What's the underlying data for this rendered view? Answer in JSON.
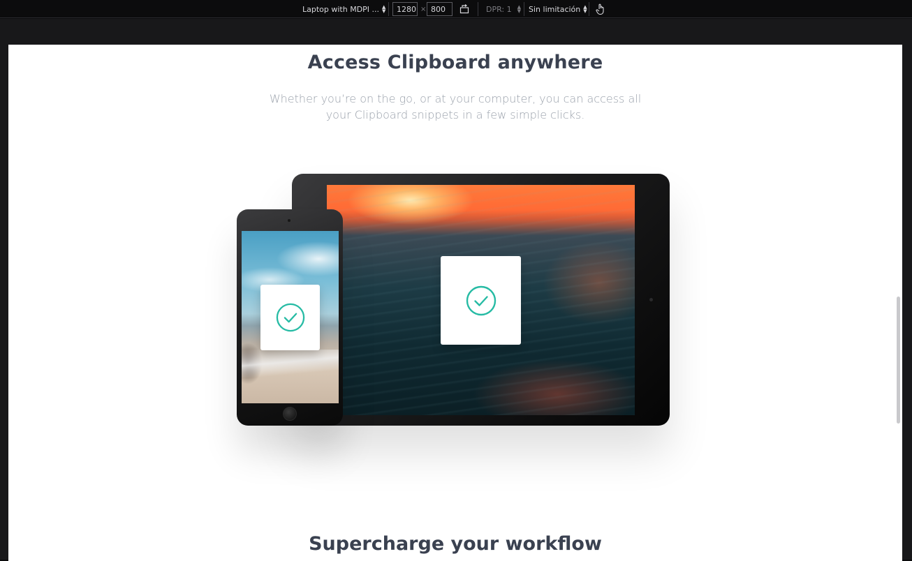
{
  "devtools": {
    "device_label": "Laptop with MDPI ...",
    "width_value": "1280",
    "times": "×",
    "height_value": "800",
    "dpr_label": "DPR: 1",
    "throttle_label": "Sin limitación",
    "rotate_icon": "rotate-icon",
    "touch_icon": "touch-hand-icon"
  },
  "page": {
    "heading": "Access Clipboard anywhere",
    "lead": "Whether you’re on the go, or at your computer, you can access all your Clipboard snippets in a few simple clicks.",
    "next_heading": "Supercharge your workflow",
    "check_icon": "check-circle-icon",
    "accent_color": "#26bba4"
  }
}
